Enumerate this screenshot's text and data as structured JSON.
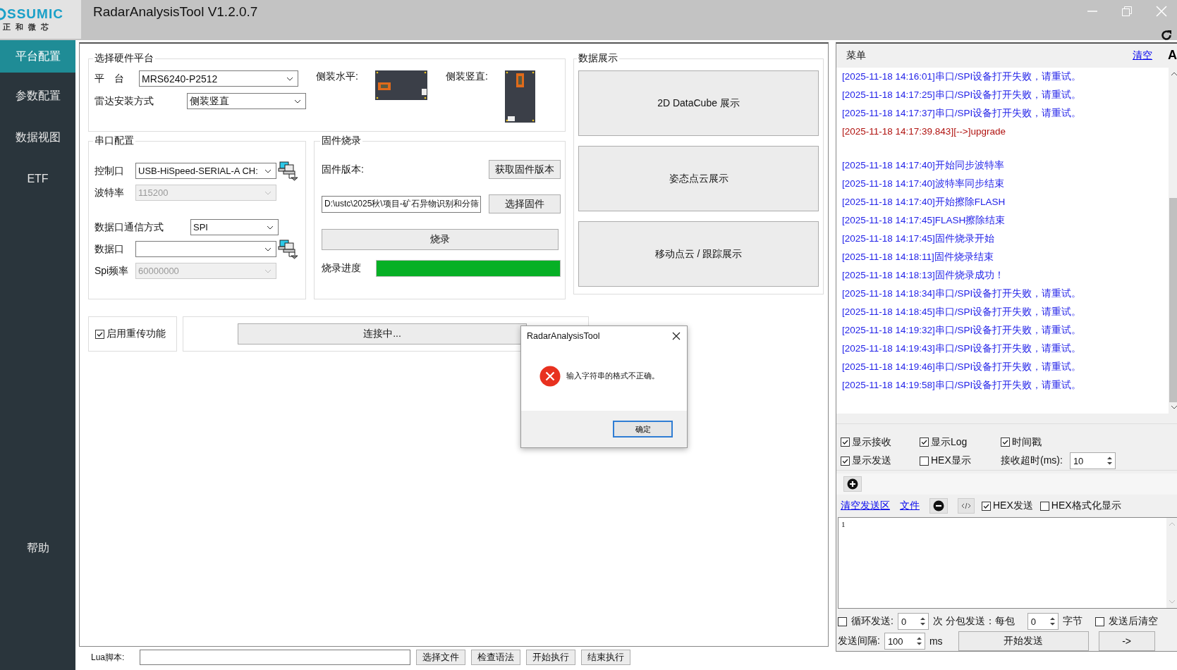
{
  "window": {
    "title": "RadarAnalysisTool V1.2.0.7",
    "logo": "SSUMIC",
    "logo_sub": "正 和 微 芯"
  },
  "sidebar": {
    "items": [
      {
        "label": "平台配置",
        "selected": true
      },
      {
        "label": "参数配置",
        "selected": false
      },
      {
        "label": "数据视图",
        "selected": false
      },
      {
        "label": "ETF",
        "selected": false
      }
    ],
    "help": "帮助"
  },
  "hardware": {
    "title": "选择硬件平台",
    "platform_label": "平　台",
    "platform_value": "MRS6240-P2512",
    "mount_label": "雷达安装方式",
    "mount_value": "侧装竖直",
    "horizontal_label": "侧装水平:",
    "vertical_label": "侧装竖直:"
  },
  "serial": {
    "title": "串口配置",
    "fields": [
      {
        "kind": "port",
        "label": "控制口",
        "value": "USB-HiSpeed-SERIAL-A CH:",
        "disabled": false
      },
      {
        "kind": "plain",
        "label": "波特率",
        "value": "115200",
        "disabled": true
      },
      {
        "kind": "mode",
        "label": "数据口通信方式",
        "value": "SPI",
        "disabled": false
      },
      {
        "kind": "port",
        "label": "数据口",
        "disabled": false
      },
      {
        "kind": "plain",
        "label": "Spi频率",
        "value": "60000000",
        "disabled": true
      }
    ]
  },
  "firmware": {
    "title": "固件烧录",
    "version_label": "固件版本:",
    "get_button": "获取固件版本",
    "path": "D:\\ustc\\2025秋\\项目-矿石异物识别和分筛",
    "choose_button": "选择固件",
    "burn_button": "烧录",
    "progress_label": "烧录进度",
    "level": 1
  },
  "display": {
    "title": "数据展示",
    "buttons": [
      "2D DataCube 展示",
      "姿态点云展示",
      "移动点云 / 跟踪展示"
    ]
  },
  "retransmit": {
    "label": "启用重传功能",
    "checked": true
  },
  "connect_button": "连接中...",
  "dialog": {
    "title": "RadarAnalysisTool",
    "message": "输入字符串的格式不正确。",
    "ok": "确定"
  },
  "log_panel": {
    "title": "菜单",
    "clear": "清空",
    "font_button": "A",
    "entries": [
      {
        "kind": "info",
        "text": "[2025-11-18 14:16:01]串口/SPI设备打开失败，请重试。"
      },
      {
        "kind": "info",
        "text": "[2025-11-18 14:17:25]串口/SPI设备打开失败，请重试。"
      },
      {
        "kind": "info",
        "text": "[2025-11-18 14:17:37]串口/SPI设备打开失败，请重试。"
      },
      {
        "kind": "sent",
        "text": "[2025-11-18 14:17:39.843][-->]upgrade"
      },
      {
        "kind": "info",
        "text": "[2025-11-18 14:17:40]开始同步波特率"
      },
      {
        "kind": "info",
        "text": "[2025-11-18 14:17:40]波特率同步结束"
      },
      {
        "kind": "info",
        "text": "[2025-11-18 14:17:40]开始擦除FLASH"
      },
      {
        "kind": "info",
        "text": "[2025-11-18 14:17:45]FLASH擦除结束"
      },
      {
        "kind": "info",
        "text": "[2025-11-18 14:17:45]固件烧录开始"
      },
      {
        "kind": "info",
        "text": "[2025-11-18 14:18:11]固件烧录结束"
      },
      {
        "kind": "info",
        "text": "[2025-11-18 14:18:13]固件烧录成功！"
      },
      {
        "kind": "info",
        "text": "[2025-11-18 14:18:34]串口/SPI设备打开失败，请重试。"
      },
      {
        "kind": "info",
        "text": "[2025-11-18 14:18:45]串口/SPI设备打开失败，请重试。"
      },
      {
        "kind": "info",
        "text": "[2025-11-18 14:19:32]串口/SPI设备打开失败，请重试。"
      },
      {
        "kind": "info",
        "text": "[2025-11-18 14:19:43]串口/SPI设备打开失败，请重试。"
      },
      {
        "kind": "info",
        "text": "[2025-11-18 14:19:46]串口/SPI设备打开失败，请重试。"
      },
      {
        "kind": "info",
        "text": "[2025-11-18 14:19:58]串口/SPI设备打开失败，请重试。"
      }
    ]
  },
  "options": [
    {
      "label": "显示接收",
      "checked": true
    },
    {
      "label": "显示Log",
      "checked": true
    },
    {
      "label": "时间戳",
      "checked": true
    },
    {
      "label": "显示发送",
      "checked": true
    },
    {
      "label": "HEX显示",
      "checked": false
    }
  ],
  "timeout": {
    "label": "接收超时(ms):",
    "value": "10"
  },
  "send": {
    "clear_link": "清空发送区",
    "file_link": "文件",
    "hex_options": [
      {
        "label": "HEX发送",
        "checked": true
      },
      {
        "label": "HEX格式化显示",
        "checked": false
      }
    ],
    "text": "1",
    "loop": {
      "label": "循环发送:",
      "checked": false,
      "count": "0",
      "split_label": "次 分包发送：每包",
      "split": "0",
      "unit": "字节"
    },
    "clear_after": {
      "label": "发送后清空",
      "checked": false
    },
    "interval_label": "发送间隔:",
    "interval": "100",
    "interval_unit": "ms",
    "start_button": "开始发送",
    "arrow_button": "->"
  },
  "lua": {
    "label": "Lua脚本:",
    "buttons": [
      "选择文件",
      "检查语法",
      "开始执行",
      "结束执行"
    ]
  }
}
